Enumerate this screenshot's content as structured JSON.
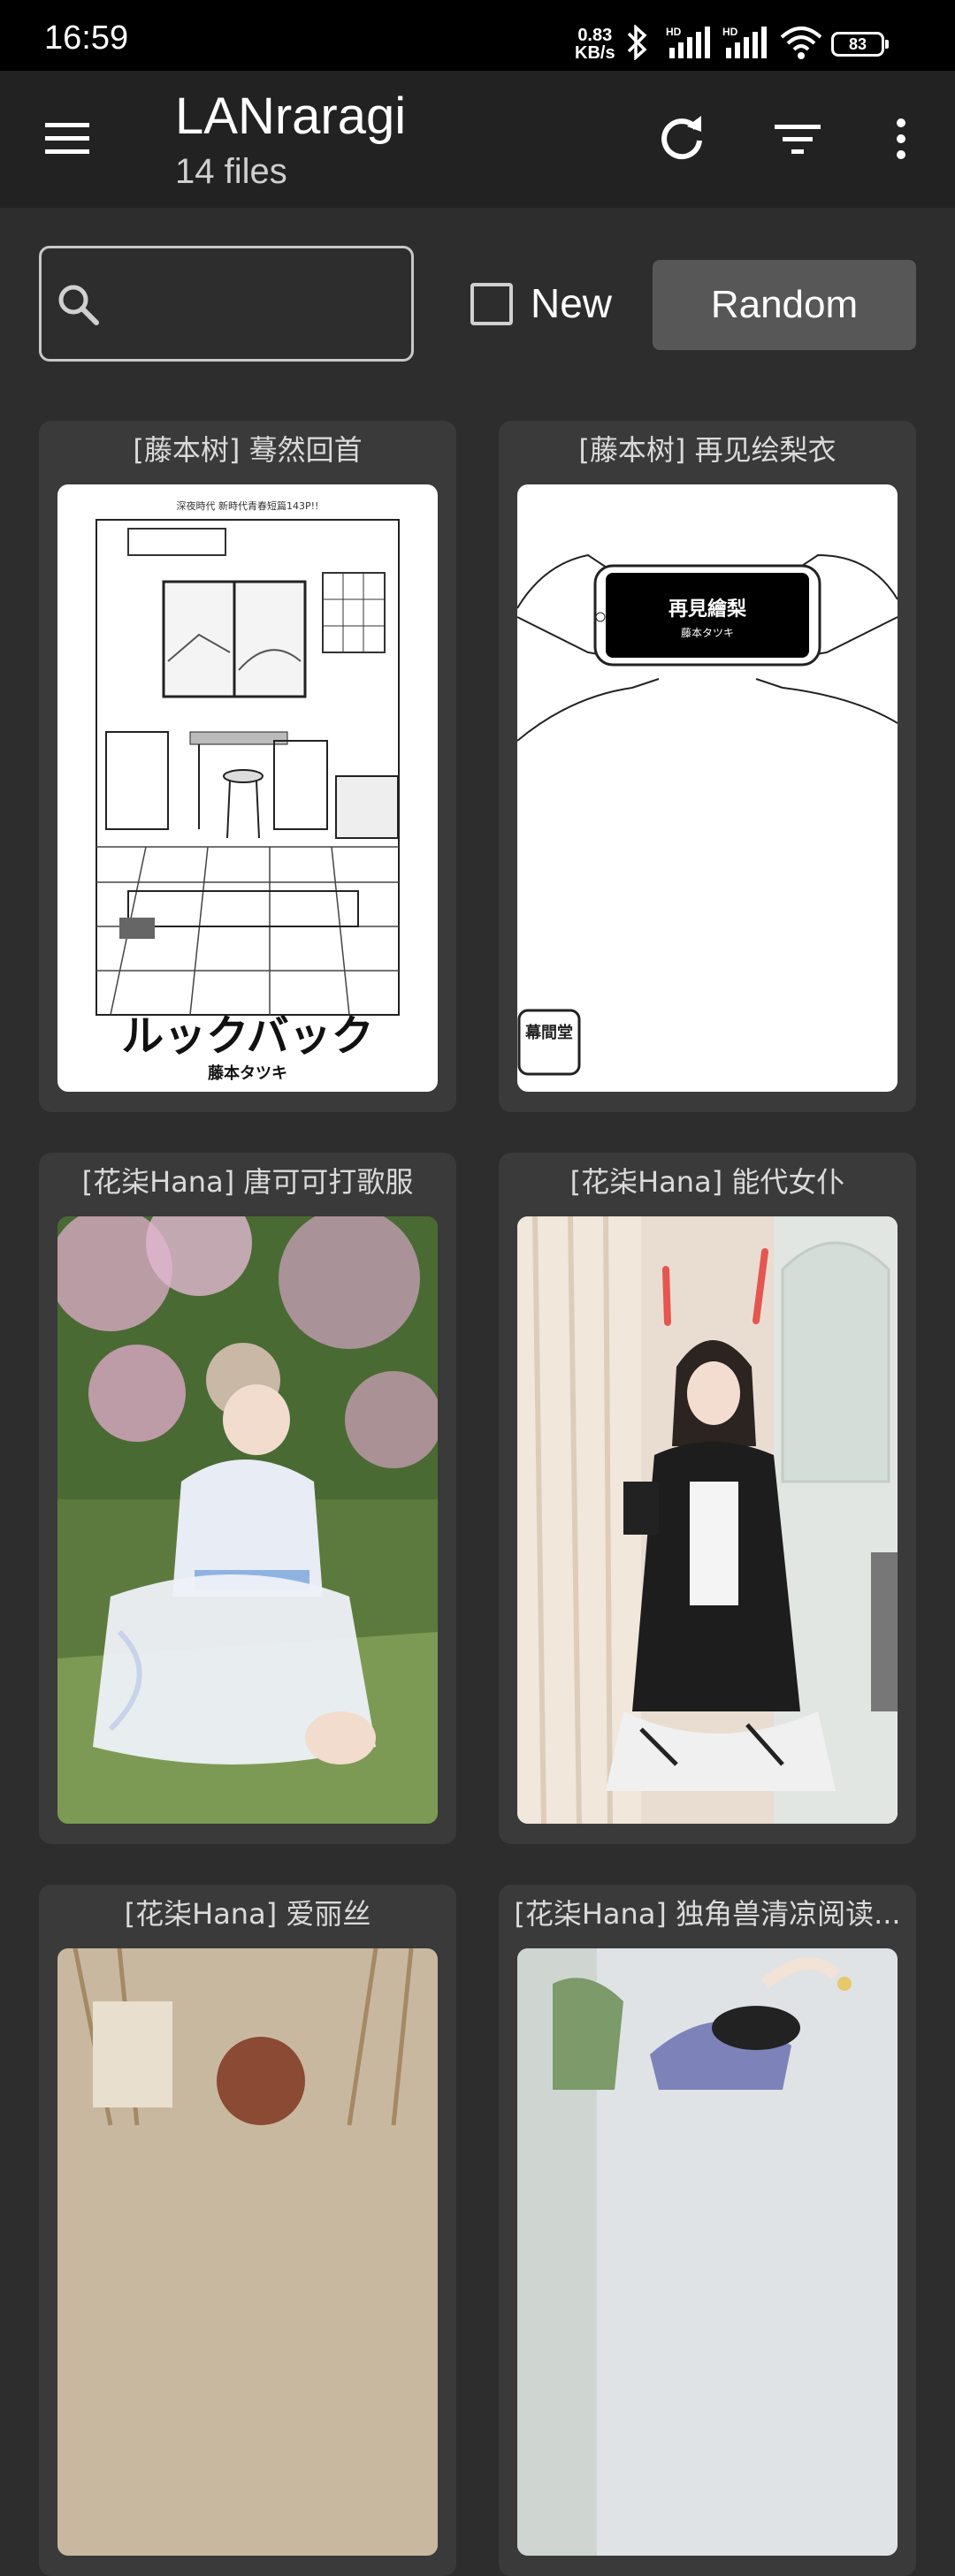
{
  "status_bar": {
    "time": "16:59",
    "speed_value": "0.83",
    "speed_unit": "KB/s",
    "battery": "83"
  },
  "app_bar": {
    "title": "LANraragi",
    "subtitle": "14 files",
    "menu_icon": "hamburger-menu-icon",
    "refresh_icon": "refresh-icon",
    "filter_icon": "filter-icon",
    "overflow_icon": "more-vert-icon"
  },
  "search": {
    "placeholder": "",
    "value": "",
    "new_label": "New",
    "new_checked": false,
    "random_label": "Random"
  },
  "archives": [
    {
      "title": "[藤本树] 蓦然回首",
      "cover_text": "ルックバック",
      "cover_author": "藤本タツキ",
      "cover_caption": "深夜時代 新時代青春短篇143P!!"
    },
    {
      "title": "[藤本树] 再见绘梨衣",
      "cover_text": "再見繪梨",
      "cover_author": "藤本タツキ",
      "cover_stamp": "幕間堂"
    },
    {
      "title": "[花柒Hana] 唐可可打歌服"
    },
    {
      "title": "[花柒Hana] 能代女仆"
    },
    {
      "title": "[花柒Hana] 爱丽丝"
    },
    {
      "title": "[花柒Hana] 独角兽清凉阅读..."
    }
  ],
  "colors": {
    "background": "#2d2d2d",
    "app_bar": "#222222",
    "card": "#3a3a3a",
    "random_button": "#575757"
  }
}
